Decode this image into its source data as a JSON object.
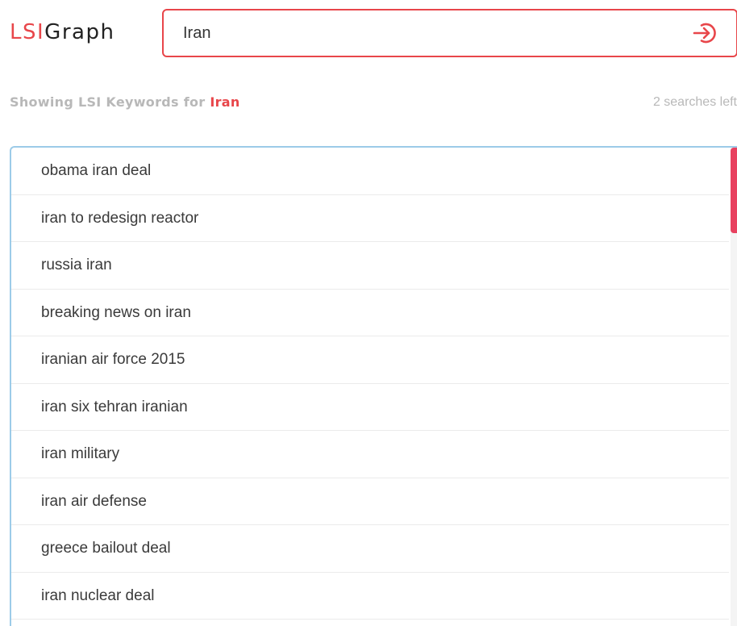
{
  "header": {
    "logo_part1": "LSI",
    "logo_part2": "Graph"
  },
  "search": {
    "value": "Iran",
    "submit_icon": "arrow-into-circle-icon"
  },
  "status": {
    "showing_prefix": "Showing LSI Keywords for",
    "showing_term": "Iran",
    "searches_left": "2 searches left"
  },
  "results": [
    "obama iran deal",
    "iran to redesign reactor",
    "russia iran",
    "breaking news on iran",
    "iranian air force 2015",
    "iran six tehran iranian",
    "iran military",
    "iran air defense",
    "greece bailout deal",
    "iran nuclear deal"
  ],
  "colors": {
    "accent": "#e8464a",
    "list_border": "#9ccbe8",
    "scrollbar_thumb": "#e8415f",
    "muted_text": "#b8b8b8"
  }
}
